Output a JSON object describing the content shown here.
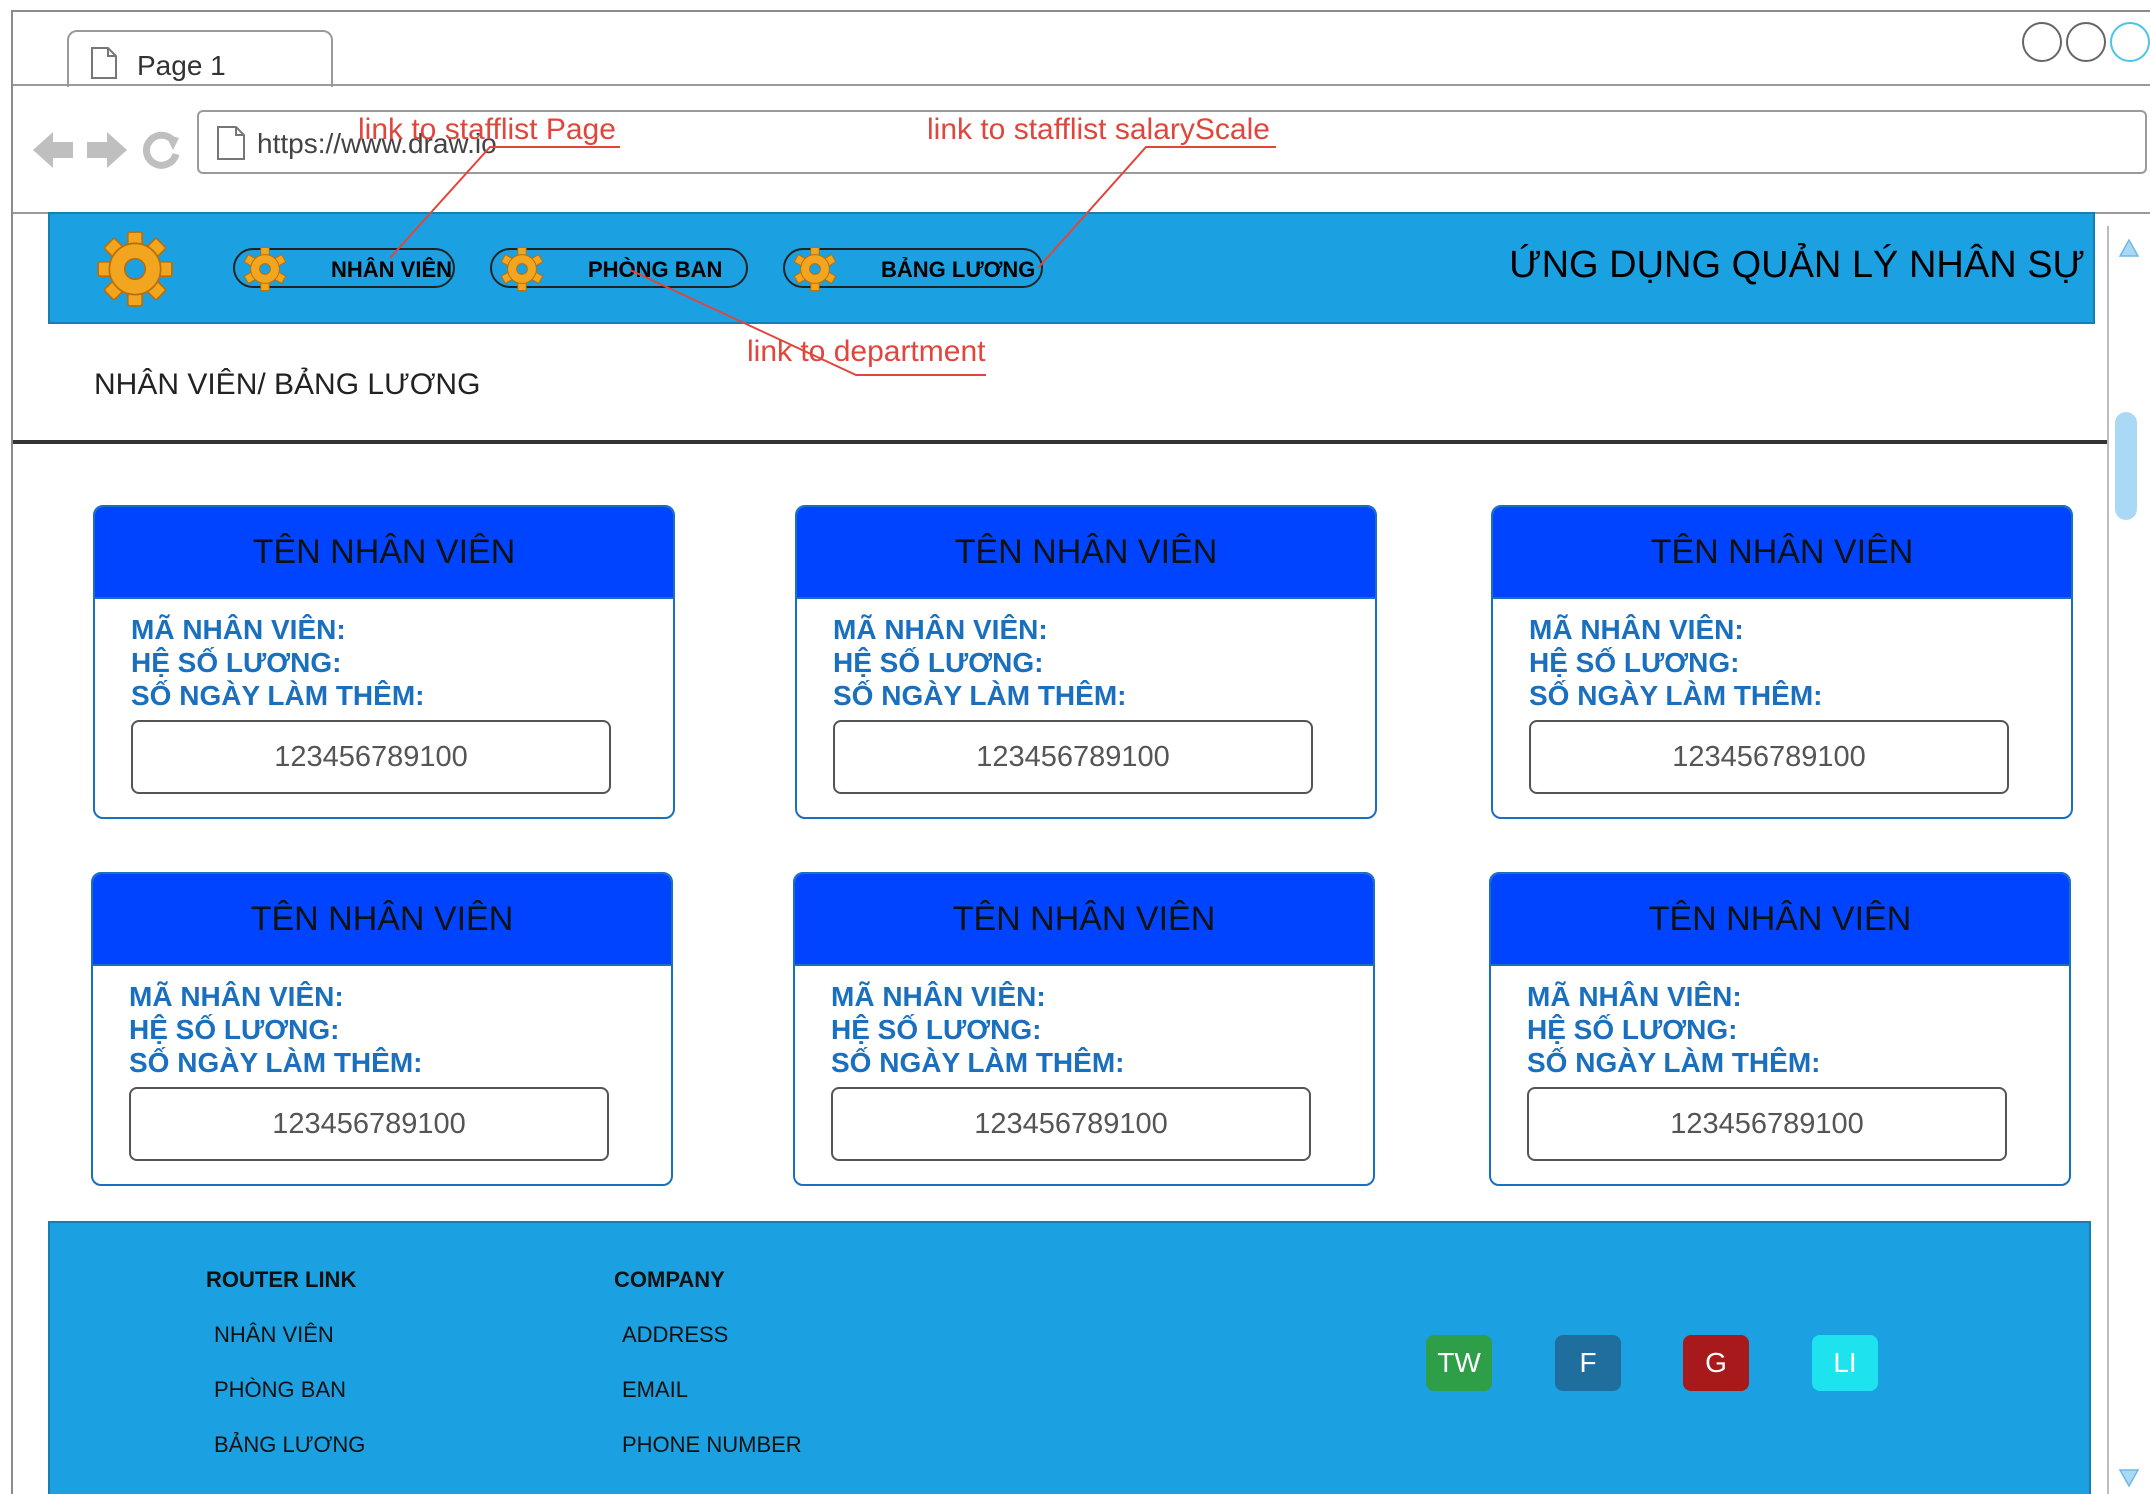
{
  "browser": {
    "tab_title": "Page 1",
    "url": "https://www.draw.io"
  },
  "header": {
    "title": "ỨNG DỤNG QUẢN LÝ NHÂN SỰ",
    "nav": [
      {
        "label": "NHÂN VIÊN"
      },
      {
        "label": "PHÒNG BAN"
      },
      {
        "label": "BẢNG LƯƠNG"
      }
    ]
  },
  "breadcrumb": "NHÂN VIÊN/ BẢNG LƯƠNG",
  "annotations": {
    "staff_link": "link to stafflist Page",
    "salary_link": "link to stafflist salaryScale",
    "department_link": "link to department"
  },
  "cards": [
    {
      "title": "TÊN NHÂN VIÊN",
      "id_label": "MÃ NHÂN VIÊN:",
      "coef_label": "HỆ SỐ LƯƠNG:",
      "overtime_label": "SỐ NGÀY LÀM THÊM:",
      "value": "123456789100"
    },
    {
      "title": "TÊN NHÂN VIÊN",
      "id_label": "MÃ NHÂN VIÊN:",
      "coef_label": "HỆ SỐ LƯƠNG:",
      "overtime_label": "SỐ NGÀY LÀM THÊM:",
      "value": "123456789100"
    },
    {
      "title": "TÊN NHÂN VIÊN",
      "id_label": "MÃ NHÂN VIÊN:",
      "coef_label": "HỆ SỐ LƯƠNG:",
      "overtime_label": "SỐ NGÀY LÀM THÊM:",
      "value": "123456789100"
    },
    {
      "title": "TÊN NHÂN VIÊN",
      "id_label": "MÃ NHÂN VIÊN:",
      "coef_label": "HỆ SỐ LƯƠNG:",
      "overtime_label": "SỐ NGÀY LÀM THÊM:",
      "value": "123456789100"
    },
    {
      "title": "TÊN NHÂN VIÊN",
      "id_label": "MÃ NHÂN VIÊN:",
      "coef_label": "HỆ SỐ LƯƠNG:",
      "overtime_label": "SỐ NGÀY LÀM THÊM:",
      "value": "123456789100"
    },
    {
      "title": "TÊN NHÂN VIÊN",
      "id_label": "MÃ NHÂN VIÊN:",
      "coef_label": "HỆ SỐ LƯƠNG:",
      "overtime_label": "SỐ NGÀY LÀM THÊM:",
      "value": "123456789100"
    }
  ],
  "footer": {
    "router_heading": "ROUTER LINK",
    "router_links": [
      "NHÂN VIÊN",
      "PHÒNG BAN",
      "BẢNG LƯƠNG"
    ],
    "company_heading": "COMPANY",
    "company_links": [
      "ADDRESS",
      "EMAIL",
      "PHONE NUMBER"
    ],
    "social": [
      {
        "label": "TW",
        "color": "#2e9e49"
      },
      {
        "label": "F",
        "color": "#1f6e9e"
      },
      {
        "label": "G",
        "color": "#a8191b"
      },
      {
        "label": "LI",
        "color": "#1ee3ef"
      }
    ]
  },
  "colors": {
    "header_bg": "#1ba1e2",
    "card_head": "#0044ff",
    "card_text": "#1a6fbf",
    "annotation": "#e0463c"
  }
}
